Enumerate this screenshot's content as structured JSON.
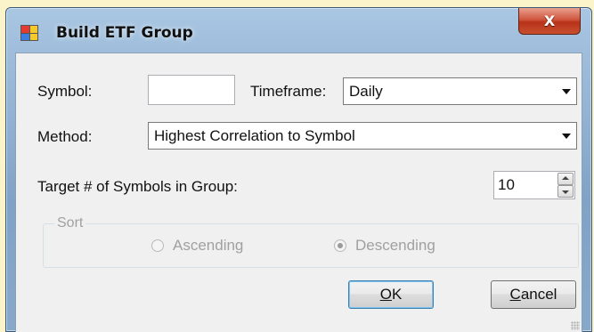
{
  "window": {
    "title": "Build ETF Group",
    "close_label": "X"
  },
  "form": {
    "symbol_label": "Symbol:",
    "symbol_value": "",
    "timeframe_label": "Timeframe:",
    "timeframe_value": "Daily",
    "method_label": "Method:",
    "method_value": "Highest Correlation to Symbol",
    "target_label": "Target # of Symbols in Group:",
    "target_value": "10"
  },
  "sort": {
    "legend": "Sort",
    "ascending_label": "Ascending",
    "descending_label": "Descending",
    "selected": "Descending",
    "enabled": false
  },
  "buttons": {
    "ok_mnemonic": "O",
    "ok_rest": "K",
    "cancel_mnemonic": "C",
    "cancel_rest": "ancel"
  },
  "colors": {
    "desktop": "#fbf3c9",
    "titlebar": "#8fb0cf",
    "client": "#f0f0f0",
    "close_button": "#c8402a",
    "disabled_text": "#a0a0a0"
  }
}
